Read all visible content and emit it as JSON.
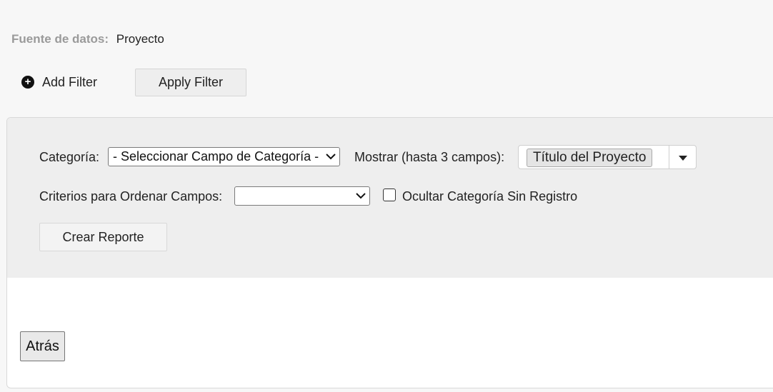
{
  "datasource": {
    "label": "Fuente de datos:",
    "value": "Proyecto"
  },
  "filters": {
    "add_label": "Add Filter",
    "apply_label": "Apply Filter",
    "plus_glyph": "+"
  },
  "report": {
    "category_label": "Categoría:",
    "category_select_value": "- Seleccionar Campo de Categoría -",
    "display_label": "Mostrar (hasta 3 campos):",
    "display_tags": [
      "Título del Proyecto"
    ],
    "sort_label": "Criterios para Ordenar Campos:",
    "sort_select_value": "",
    "hide_empty_label": "Ocultar Categoría Sin Registro",
    "hide_empty_checked": false,
    "create_label": "Crear Reporte"
  },
  "footer": {
    "back_label": "Atrás"
  },
  "icons": {
    "add": "plus-circle-icon",
    "select_arrow": "chevron-down-icon",
    "dropdown": "caret-down-icon"
  }
}
